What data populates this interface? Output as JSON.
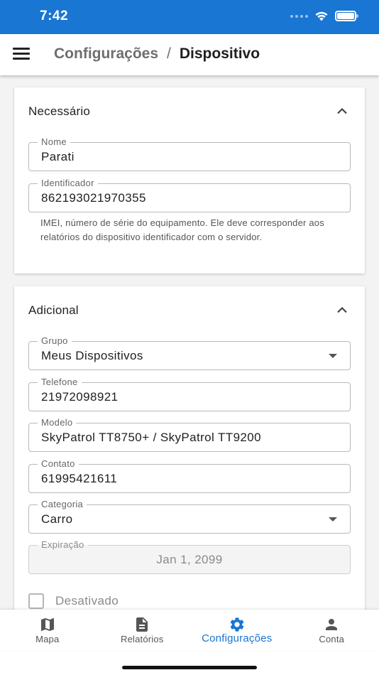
{
  "status_bar": {
    "time": "7:42"
  },
  "header": {
    "breadcrumb_parent": "Configurações",
    "breadcrumb_separator": "/",
    "breadcrumb_current": "Dispositivo"
  },
  "sections": {
    "necessario": {
      "title": "Necessário",
      "fields": {
        "nome": {
          "label": "Nome",
          "value": "Parati"
        },
        "identificador": {
          "label": "Identificador",
          "value": "862193021970355"
        }
      },
      "helper_text": "IMEI, número de série do equipamento. Ele deve corresponder aos relatórios do dispositivo identificador com o servidor."
    },
    "adicional": {
      "title": "Adicional",
      "fields": {
        "grupo": {
          "label": "Grupo",
          "value": "Meus Dispositivos"
        },
        "telefone": {
          "label": "Telefone",
          "value": "21972098921"
        },
        "modelo": {
          "label": "Modelo",
          "value": "SkyPatrol TT8750+ / SkyPatrol TT9200"
        },
        "contato": {
          "label": "Contato",
          "value": "61995421611"
        },
        "categoria": {
          "label": "Categoria",
          "value": "Carro"
        },
        "expiracao": {
          "label": "Expiração",
          "value": "Jan 1, 2099"
        }
      },
      "checkbox": {
        "label": "Desativado",
        "checked": false
      }
    }
  },
  "bottom_nav": {
    "items": [
      {
        "label": "Mapa",
        "icon": "map-icon",
        "active": false
      },
      {
        "label": "Relatórios",
        "icon": "document-icon",
        "active": false
      },
      {
        "label": "Configurações",
        "icon": "gear-icon",
        "active": true
      },
      {
        "label": "Conta",
        "icon": "person-icon",
        "active": false
      }
    ]
  },
  "colors": {
    "primary": "#1976d2",
    "inactive_nav": "#555555"
  }
}
